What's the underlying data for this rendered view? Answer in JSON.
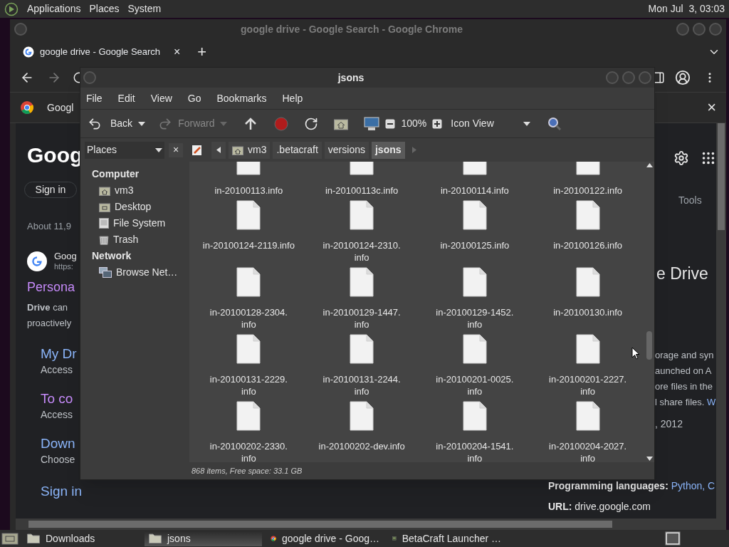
{
  "top_panel": {
    "menus": [
      "Applications",
      "Places",
      "System"
    ],
    "clock": "Mon Jul  3, 03:03"
  },
  "browser": {
    "title": "google drive - Google Search - Google Chrome",
    "tab": {
      "label": "google drive - Google Search",
      "close": "×"
    },
    "new_tab": "+",
    "bookmark": "Googl",
    "infobar_close": "×",
    "left": {
      "logo": "Goog",
      "sign_in_button": "Sign in",
      "result_stats": "About 11,9",
      "result_site": "Goog",
      "result_url": "https:",
      "result_title": "Persona",
      "snippet_1": "**Drive** can",
      "snippet_2": "proactively",
      "links": [
        {
          "title": "My Dr",
          "desc": "Access",
          "visited": false
        },
        {
          "title": "To co",
          "desc": "Access",
          "visited": true
        },
        {
          "title": "Down",
          "desc": "Choose",
          "visited": false
        }
      ],
      "sign_in_link": "Sign in"
    },
    "right": {
      "tools": "Tools",
      "panel_title": "e Drive",
      "panel_lines": [
        "orage and syn",
        "aunched on A",
        "ore files in the"
      ],
      "panel_line_4": "l share files.",
      "panel_link": "W",
      "date": ", 2012",
      "languages_label": "Programming languages:",
      "languages_value": "Python, C",
      "url_label": "URL:",
      "url_value": "drive.google.com"
    }
  },
  "file_manager": {
    "title": "jsons",
    "menu": [
      "File",
      "Edit",
      "View",
      "Go",
      "Bookmarks",
      "Help"
    ],
    "toolbar": {
      "back": "Back",
      "forward": "Forward",
      "zoom": "100%",
      "view": "Icon View"
    },
    "sidebar": {
      "selector": "Places",
      "close": "×",
      "sections": [
        {
          "heading": "Computer",
          "items": [
            {
              "label": "vm3",
              "kind": "home",
              "selected": false
            },
            {
              "label": "Desktop",
              "kind": "desktop",
              "selected": false
            },
            {
              "label": "File System",
              "kind": "drive",
              "selected": false
            },
            {
              "label": "Trash",
              "kind": "trash",
              "selected": false
            }
          ]
        },
        {
          "heading": "Network",
          "items": [
            {
              "label": "Browse Net…",
              "kind": "network",
              "selected": false
            }
          ]
        }
      ]
    },
    "path": [
      {
        "label": "vm3",
        "home": true,
        "selected": false
      },
      {
        "label": ".betacraft",
        "home": false,
        "selected": false
      },
      {
        "label": "versions",
        "home": false,
        "selected": false
      },
      {
        "label": "jsons",
        "home": false,
        "selected": true
      }
    ],
    "files": [
      "in-20100113.info",
      "in-20100113c.info",
      "in-20100114.info",
      "in-20100122.info",
      "in-20100124-2119.info",
      "in-20100124-2310.\ninfo",
      "in-20100125.info",
      "in-20100126.info",
      "in-20100128-2304.\ninfo",
      "in-20100129-1447.\ninfo",
      "in-20100129-1452.\ninfo",
      "in-20100130.info",
      "in-20100131-2229.\ninfo",
      "in-20100131-2244.\ninfo",
      "in-20100201-0025.\ninfo",
      "in-20100201-2227.\ninfo",
      "in-20100202-2330.\ninfo",
      "in-20100202-dev.info",
      "in-20100204-1541.\ninfo",
      "in-20100204-2027.\ninfo"
    ],
    "status": "868 items, Free space: 33.1 GB"
  },
  "taskbar": [
    {
      "label": "Downloads",
      "kind": "folder",
      "selected": false
    },
    {
      "label": "jsons",
      "kind": "folder",
      "selected": true
    },
    {
      "label": "google drive - Goog…",
      "kind": "browser",
      "selected": false
    },
    {
      "label": "BetaCraft Launcher …",
      "kind": "app",
      "selected": false
    }
  ]
}
